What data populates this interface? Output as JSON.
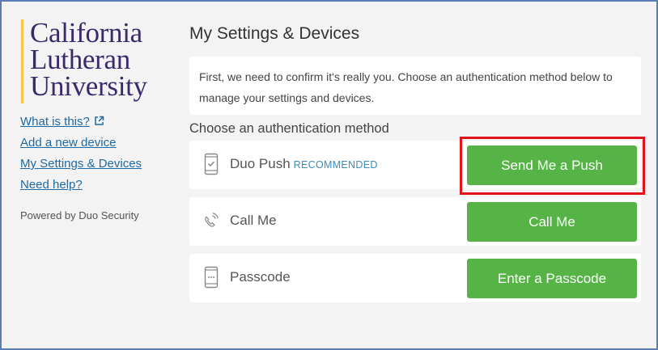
{
  "sidebar": {
    "logo": [
      "California",
      "Lutheran",
      "University"
    ],
    "links": [
      {
        "label": "What is this?",
        "external": true
      },
      {
        "label": "Add a new device"
      },
      {
        "label": "My Settings & Devices"
      },
      {
        "label": "Need help?"
      }
    ],
    "powered_by": "Powered by Duo Security"
  },
  "main": {
    "title": "My Settings & Devices",
    "info_text": "First, we need to confirm it's really you. Choose an authentication method below to manage your settings and devices.",
    "choose_label": "Choose an authentication method",
    "methods": [
      {
        "label": "Duo Push",
        "badge": "RECOMMENDED",
        "icon": "smartphone-check-icon",
        "button": "Send Me a Push"
      },
      {
        "label": "Call Me",
        "badge": "",
        "icon": "phone-ringing-icon",
        "button": "Call Me"
      },
      {
        "label": "Passcode",
        "badge": "",
        "icon": "smartphone-passcode-icon",
        "button": "Enter a Passcode"
      }
    ]
  },
  "colors": {
    "button_green": "#56b446",
    "link_blue": "#1d6aa6",
    "logo_purple": "#3b2a6b",
    "logo_gold": "#f6c64f",
    "highlight_red": "#e3131b",
    "frame_border": "#5b7cb4"
  }
}
